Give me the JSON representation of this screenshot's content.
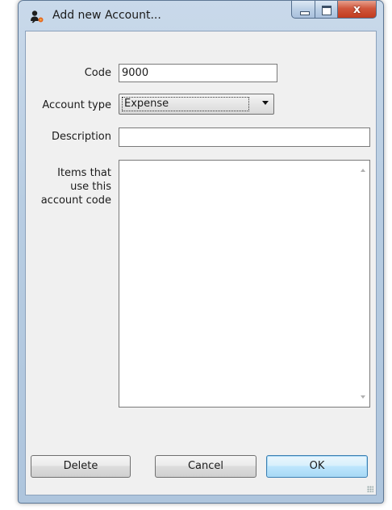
{
  "window": {
    "title": "Add new Account...",
    "close_glyph": "x"
  },
  "form": {
    "code_label": "Code",
    "code_value": "9000",
    "account_type_label": "Account type",
    "account_type_value": "Expense",
    "description_label": "Description",
    "description_value": "",
    "items_label_line1": "Items that",
    "items_label_line2": "use this",
    "items_label_line3": "account code"
  },
  "buttons": {
    "delete_label": "Delete",
    "cancel_label": "Cancel",
    "ok_label": "OK"
  },
  "icons": {
    "app": "account-person-icon",
    "minimize": "minimize-icon",
    "maximize": "maximize-icon",
    "close": "close-icon",
    "dropdown": "chevron-down-icon"
  },
  "colors": {
    "title_bar": "#b8cde2",
    "close_button": "#c23b1e",
    "default_button_border": "#3c7fb1",
    "client_background": "#f0f0f0"
  }
}
